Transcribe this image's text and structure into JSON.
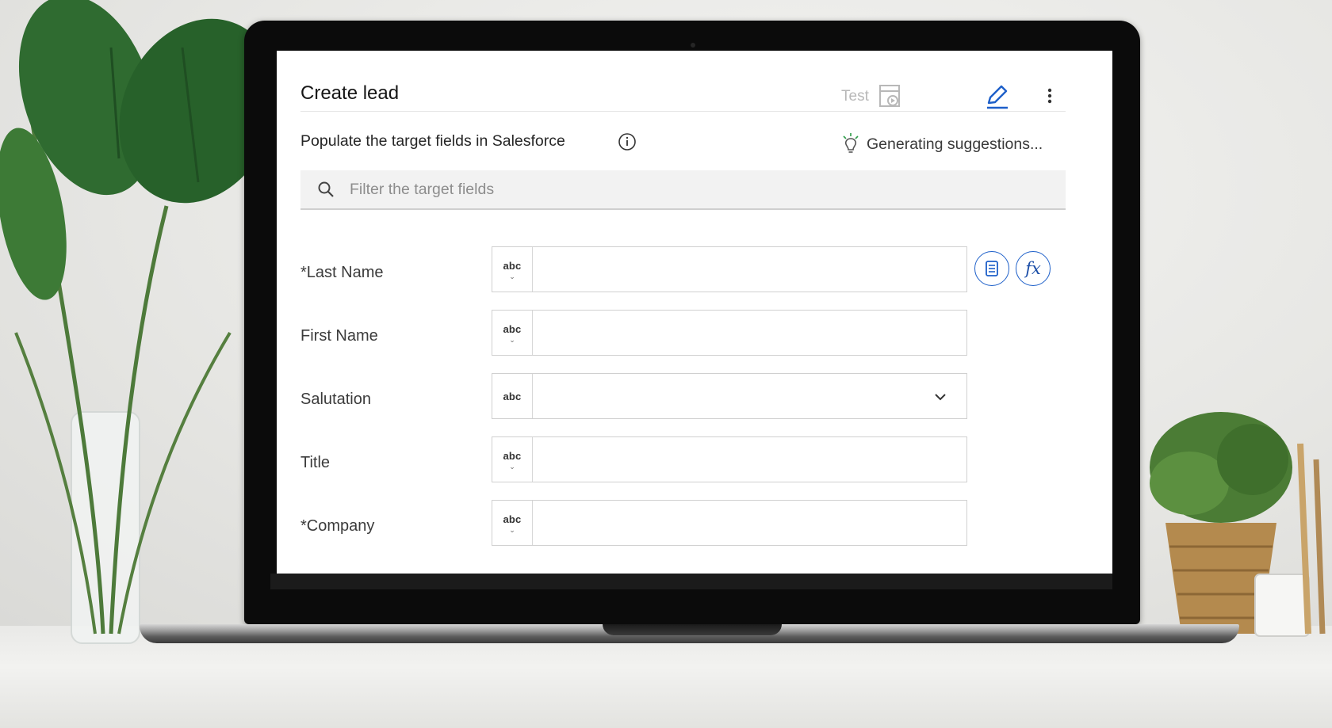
{
  "panel": {
    "title": "Create lead",
    "test_label": "Test",
    "subtitle": "Populate the target fields in Salesforce",
    "suggestions_status": "Generating suggestions...",
    "search": {
      "placeholder": "Filter the target fields"
    },
    "accent_color": "#1d5fc9"
  },
  "icons": {
    "test": "test-run-icon",
    "edit": "pencil-icon",
    "more": "overflow-menu-icon",
    "info": "info-icon",
    "suggest": "lightbulb-icon",
    "search": "search-icon",
    "mapping": "list-mapping-icon",
    "function": "fx-function-icon"
  },
  "fields": [
    {
      "label": "*Last Name",
      "type": "abc",
      "value": ""
    },
    {
      "label": "First Name",
      "type": "abc",
      "value": ""
    },
    {
      "label": "Salutation",
      "type": "abc",
      "value": ""
    },
    {
      "label": "Title",
      "type": "abc",
      "value": ""
    },
    {
      "label": "*Company",
      "type": "abc",
      "value": ""
    }
  ],
  "function_label": "fx"
}
